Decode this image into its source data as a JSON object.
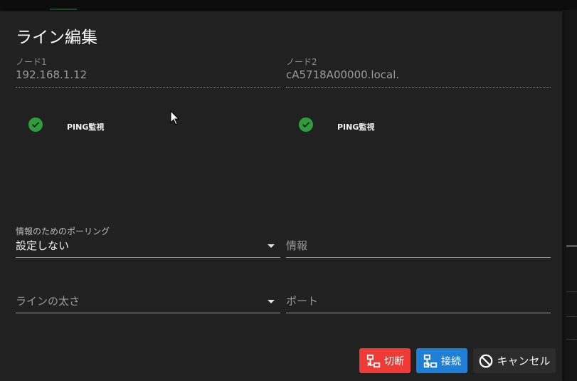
{
  "dialog": {
    "title": "ライン編集"
  },
  "node1": {
    "label": "ノード1",
    "value": "192.168.1.12",
    "ping_label": "PING監視"
  },
  "node2": {
    "label": "ノード2",
    "value": "cA5718A00000.local.",
    "ping_label": "PING監視"
  },
  "polling": {
    "label": "情報のためのポーリング",
    "value": "設定しない"
  },
  "info": {
    "placeholder": "情報"
  },
  "line_width": {
    "placeholder": "ラインの太さ"
  },
  "port": {
    "placeholder": "ポート"
  },
  "buttons": {
    "disconnect": "切断",
    "connect": "接続",
    "cancel": "キャンセル"
  },
  "colors": {
    "disconnect_bg": "#ef3a36",
    "connect_bg": "#1f7fd6",
    "check_green": "#2e9e3a",
    "dialog_bg": "#212121"
  },
  "icons": {
    "check": "check-circle-icon",
    "disconnect": "network-disconnect-icon",
    "connect": "network-connect-icon",
    "cancel": "block-icon",
    "dropdown": "caret-down-icon"
  }
}
